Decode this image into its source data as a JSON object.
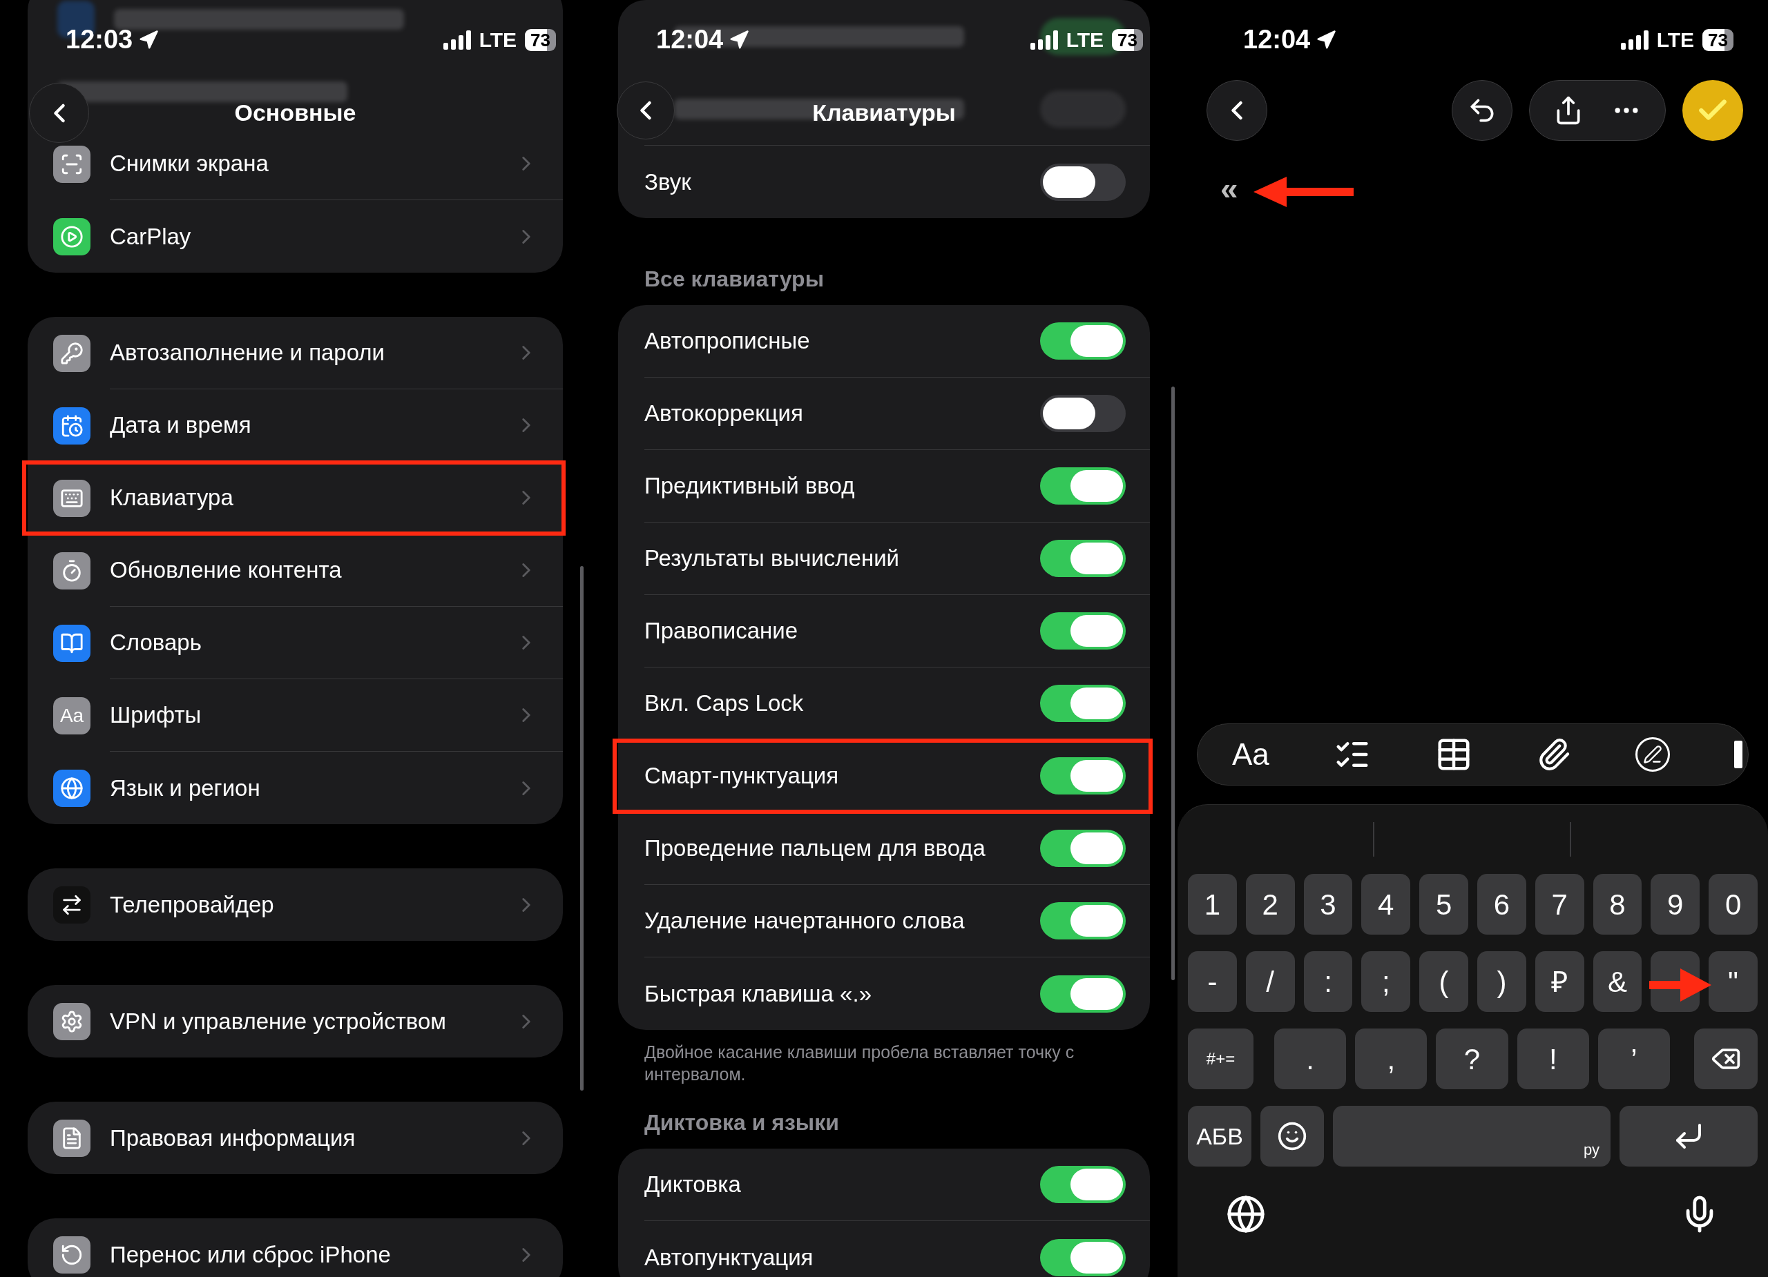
{
  "general": {
    "status": {
      "time": "12:03",
      "network": "LTE",
      "battery": "73"
    },
    "title": "Основные",
    "groups": [
      {
        "items": [
          {
            "label": "Снимки экрана",
            "color": "#8e8e93",
            "highlighted": false
          },
          {
            "label": "CarPlay",
            "color": "#34c759",
            "highlighted": false
          }
        ]
      },
      {
        "items": [
          {
            "label": "Автозаполнение и пароли",
            "color": "#8e8e93",
            "highlighted": false
          },
          {
            "label": "Дата и время",
            "color": "#1f7cf3",
            "highlighted": false
          },
          {
            "label": "Клавиатура",
            "color": "#8e8e93",
            "highlighted": true
          },
          {
            "label": "Обновление контента",
            "color": "#8e8e93",
            "highlighted": false
          },
          {
            "label": "Словарь",
            "color": "#1f7cf3",
            "highlighted": false
          },
          {
            "label": "Шрифты",
            "color": "#8e8e93",
            "icon_text": "Aa",
            "highlighted": false
          },
          {
            "label": "Язык и регион",
            "color": "#1f7cf3",
            "highlighted": false
          }
        ]
      },
      {
        "items": [
          {
            "label": "Телепровайдер",
            "color": "#111111",
            "highlighted": false
          }
        ]
      },
      {
        "items": [
          {
            "label": "VPN и управление устройством",
            "color": "#8e8e93",
            "highlighted": false
          }
        ]
      },
      {
        "items": [
          {
            "label": "Правовая информация",
            "color": "#8e8e93",
            "highlighted": false
          }
        ]
      },
      {
        "items": [
          {
            "label": "Перенос или сброс iPhone",
            "color": "#8e8e93",
            "highlighted": false
          }
        ]
      }
    ]
  },
  "keyboards": {
    "status": {
      "time": "12:04",
      "network": "LTE",
      "battery": "73"
    },
    "title": "Клавиатуры",
    "sections": [
      {
        "blurred_rows": [
          {
            "on": true
          },
          {
            "on": false
          }
        ],
        "rows": [
          {
            "label": "Звук",
            "on": false,
            "highlighted": false
          }
        ]
      },
      {
        "header": "Все клавиатуры",
        "rows": [
          {
            "label": "Автопрописные",
            "on": true,
            "highlighted": false
          },
          {
            "label": "Автокоррекция",
            "on": false,
            "highlighted": false
          },
          {
            "label": "Предиктивный ввод",
            "on": true,
            "highlighted": false
          },
          {
            "label": "Результаты вычислений",
            "on": true,
            "highlighted": false
          },
          {
            "label": "Правописание",
            "on": true,
            "highlighted": false
          },
          {
            "label": "Вкл. Caps Lock",
            "on": true,
            "highlighted": false
          },
          {
            "label": "Смарт-пунктуация",
            "on": true,
            "highlighted": true
          },
          {
            "label": "Проведение пальцем для ввода",
            "on": true,
            "highlighted": false
          },
          {
            "label": "Удаление начертанного слова",
            "on": true,
            "highlighted": false
          },
          {
            "label": "Быстрая клавиша «.»",
            "on": true,
            "highlighted": false
          }
        ],
        "footer": "Двойное касание клавиши пробела вставляет точку с интервалом."
      },
      {
        "header": "Диктовка и языки",
        "rows": [
          {
            "label": "Диктовка",
            "on": true,
            "highlighted": false
          },
          {
            "label": "Автопунктуация",
            "on": true,
            "highlighted": false
          }
        ]
      }
    ]
  },
  "notes": {
    "status": {
      "time": "12:04",
      "network": "LTE",
      "battery": "73"
    },
    "collapse_marker": "«",
    "toolbar": {
      "format_label": "Aa"
    },
    "keyboard": {
      "rows": [
        [
          {
            "kind": "char",
            "label": "1"
          },
          {
            "kind": "char",
            "label": "2"
          },
          {
            "kind": "char",
            "label": "3"
          },
          {
            "kind": "char",
            "label": "4"
          },
          {
            "kind": "char",
            "label": "5"
          },
          {
            "kind": "char",
            "label": "6"
          },
          {
            "kind": "char",
            "label": "7"
          },
          {
            "kind": "char",
            "label": "8"
          },
          {
            "kind": "char",
            "label": "9"
          },
          {
            "kind": "char",
            "label": "0"
          }
        ],
        [
          {
            "kind": "char",
            "label": "-"
          },
          {
            "kind": "char",
            "label": "/"
          },
          {
            "kind": "char",
            "label": ":"
          },
          {
            "kind": "char",
            "label": ";"
          },
          {
            "kind": "char",
            "label": "("
          },
          {
            "kind": "char",
            "label": ")"
          },
          {
            "kind": "char",
            "label": "₽"
          },
          {
            "kind": "char",
            "label": "&"
          },
          {
            "kind": "char"
          },
          {
            "kind": "char",
            "label": "\""
          }
        ],
        [
          {
            "kind": "mode",
            "label": "#+="
          },
          {
            "kind": "char",
            "label": "."
          },
          {
            "kind": "char",
            "label": ","
          },
          {
            "kind": "char",
            "label": "?"
          },
          {
            "kind": "char",
            "label": "!"
          },
          {
            "kind": "char",
            "label": "’"
          },
          {
            "kind": "backspace"
          }
        ],
        [
          {
            "kind": "mode",
            "label": "АБВ"
          },
          {
            "kind": "emoji"
          },
          {
            "kind": "space",
            "hint": "ру"
          },
          {
            "kind": "return"
          }
        ]
      ]
    }
  }
}
